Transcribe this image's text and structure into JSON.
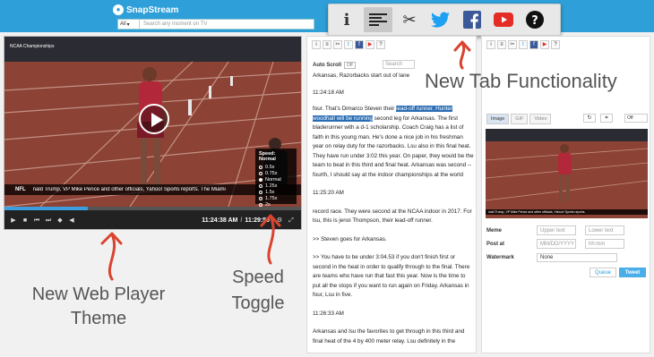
{
  "app": {
    "logo_text": "SnapStream"
  },
  "search": {
    "scope": "All",
    "placeholder": "Search any moment on TV"
  },
  "player": {
    "video_label": "NCAA Championships",
    "ticker_tag": "NFL",
    "ticker_text": "nald Trump, VP Mike Pence and other officials, Yahoo! Sports reports.  The Miami",
    "time_current": "11:24:38 AM",
    "time_end": "11:29:59",
    "progress": 0.28,
    "speed_title": "Speed: Normal",
    "speed_options": [
      "0.5x",
      "0.75x",
      "Normal",
      "1.25x",
      "1.5x",
      "1.75x",
      "2x"
    ],
    "speed_selected": "Normal"
  },
  "annotations": {
    "web_player": "New Web Player Theme",
    "speed": "Speed Toggle",
    "tab": "New Tab Functionality"
  },
  "transcript": {
    "autoscroll_label": "Auto Scroll",
    "autoscroll_state": "Off",
    "search_placeholder": "Search",
    "partial_top": "Arkansas, Razorbacks start out of lane",
    "t1": "11:24:18 AM",
    "p1_a": "four. That's Dimarco Steven their ",
    "p1_hl": "lead-off runner. Hunter woodhall will be running",
    "p1_b": " second leg for Arkansas. The first bladerunner with a d-1 scholarship. Coach Craig has a list of faith in this young man. He's done a nice job in his freshman year on relay duty for the razorbacks. Lsu also in this final heat. They have run under 3:02 this year. On paper, they would be the team to beat in this third and final heat. Arkansas was second -- fourth, I should say at the indoor championships at the world",
    "t2": "11:25:20 AM",
    "p2": "record race. They were second at the NCAA indoor in 2017. For lsu, this is jenoi Thompson, their lead-off runner.",
    "p3": ">> Steven goes for Arkansas.",
    "p4": ">> You have to be under 3:04.53 if you don't finish first or second in the heat in order to qualify through to the final. There are teams who have run that fast this year. Now is the time to put all the stops if you want to run again on Friday. Arkansas in four, Lsu in five.",
    "t3": "11:26:33 AM",
    "p5": "Arkansas and lsu the favorites to get through in this third and final heat of the 4 by 400 meter relay. Lsu definitely in the"
  },
  "right_panel": {
    "tabs": [
      "Image",
      "GIF",
      "Video"
    ],
    "active_tab": "Image",
    "select_value": "Off",
    "thumb_ticker": "nald Trump, VP Mike Pence and other officials, Yahoo! Sports reports.",
    "meme_label": "Meme",
    "upper_placeholder": "Upper text",
    "lower_placeholder": "Lower text",
    "post_at_label": "Post at",
    "date_placeholder": "MM/DD/YYYY",
    "time_placeholder": "hh:mm",
    "watermark_label": "Watermark",
    "watermark_value": "None",
    "queue_label": "Queue",
    "tweet_label": "Tweet"
  },
  "colors": {
    "brand": "#2e9fd8",
    "twitter": "#1da1f2",
    "facebook": "#3b5998",
    "youtube": "#e52d27",
    "highlight": "#2a6db5",
    "annotation_arrow": "#d9432f"
  }
}
